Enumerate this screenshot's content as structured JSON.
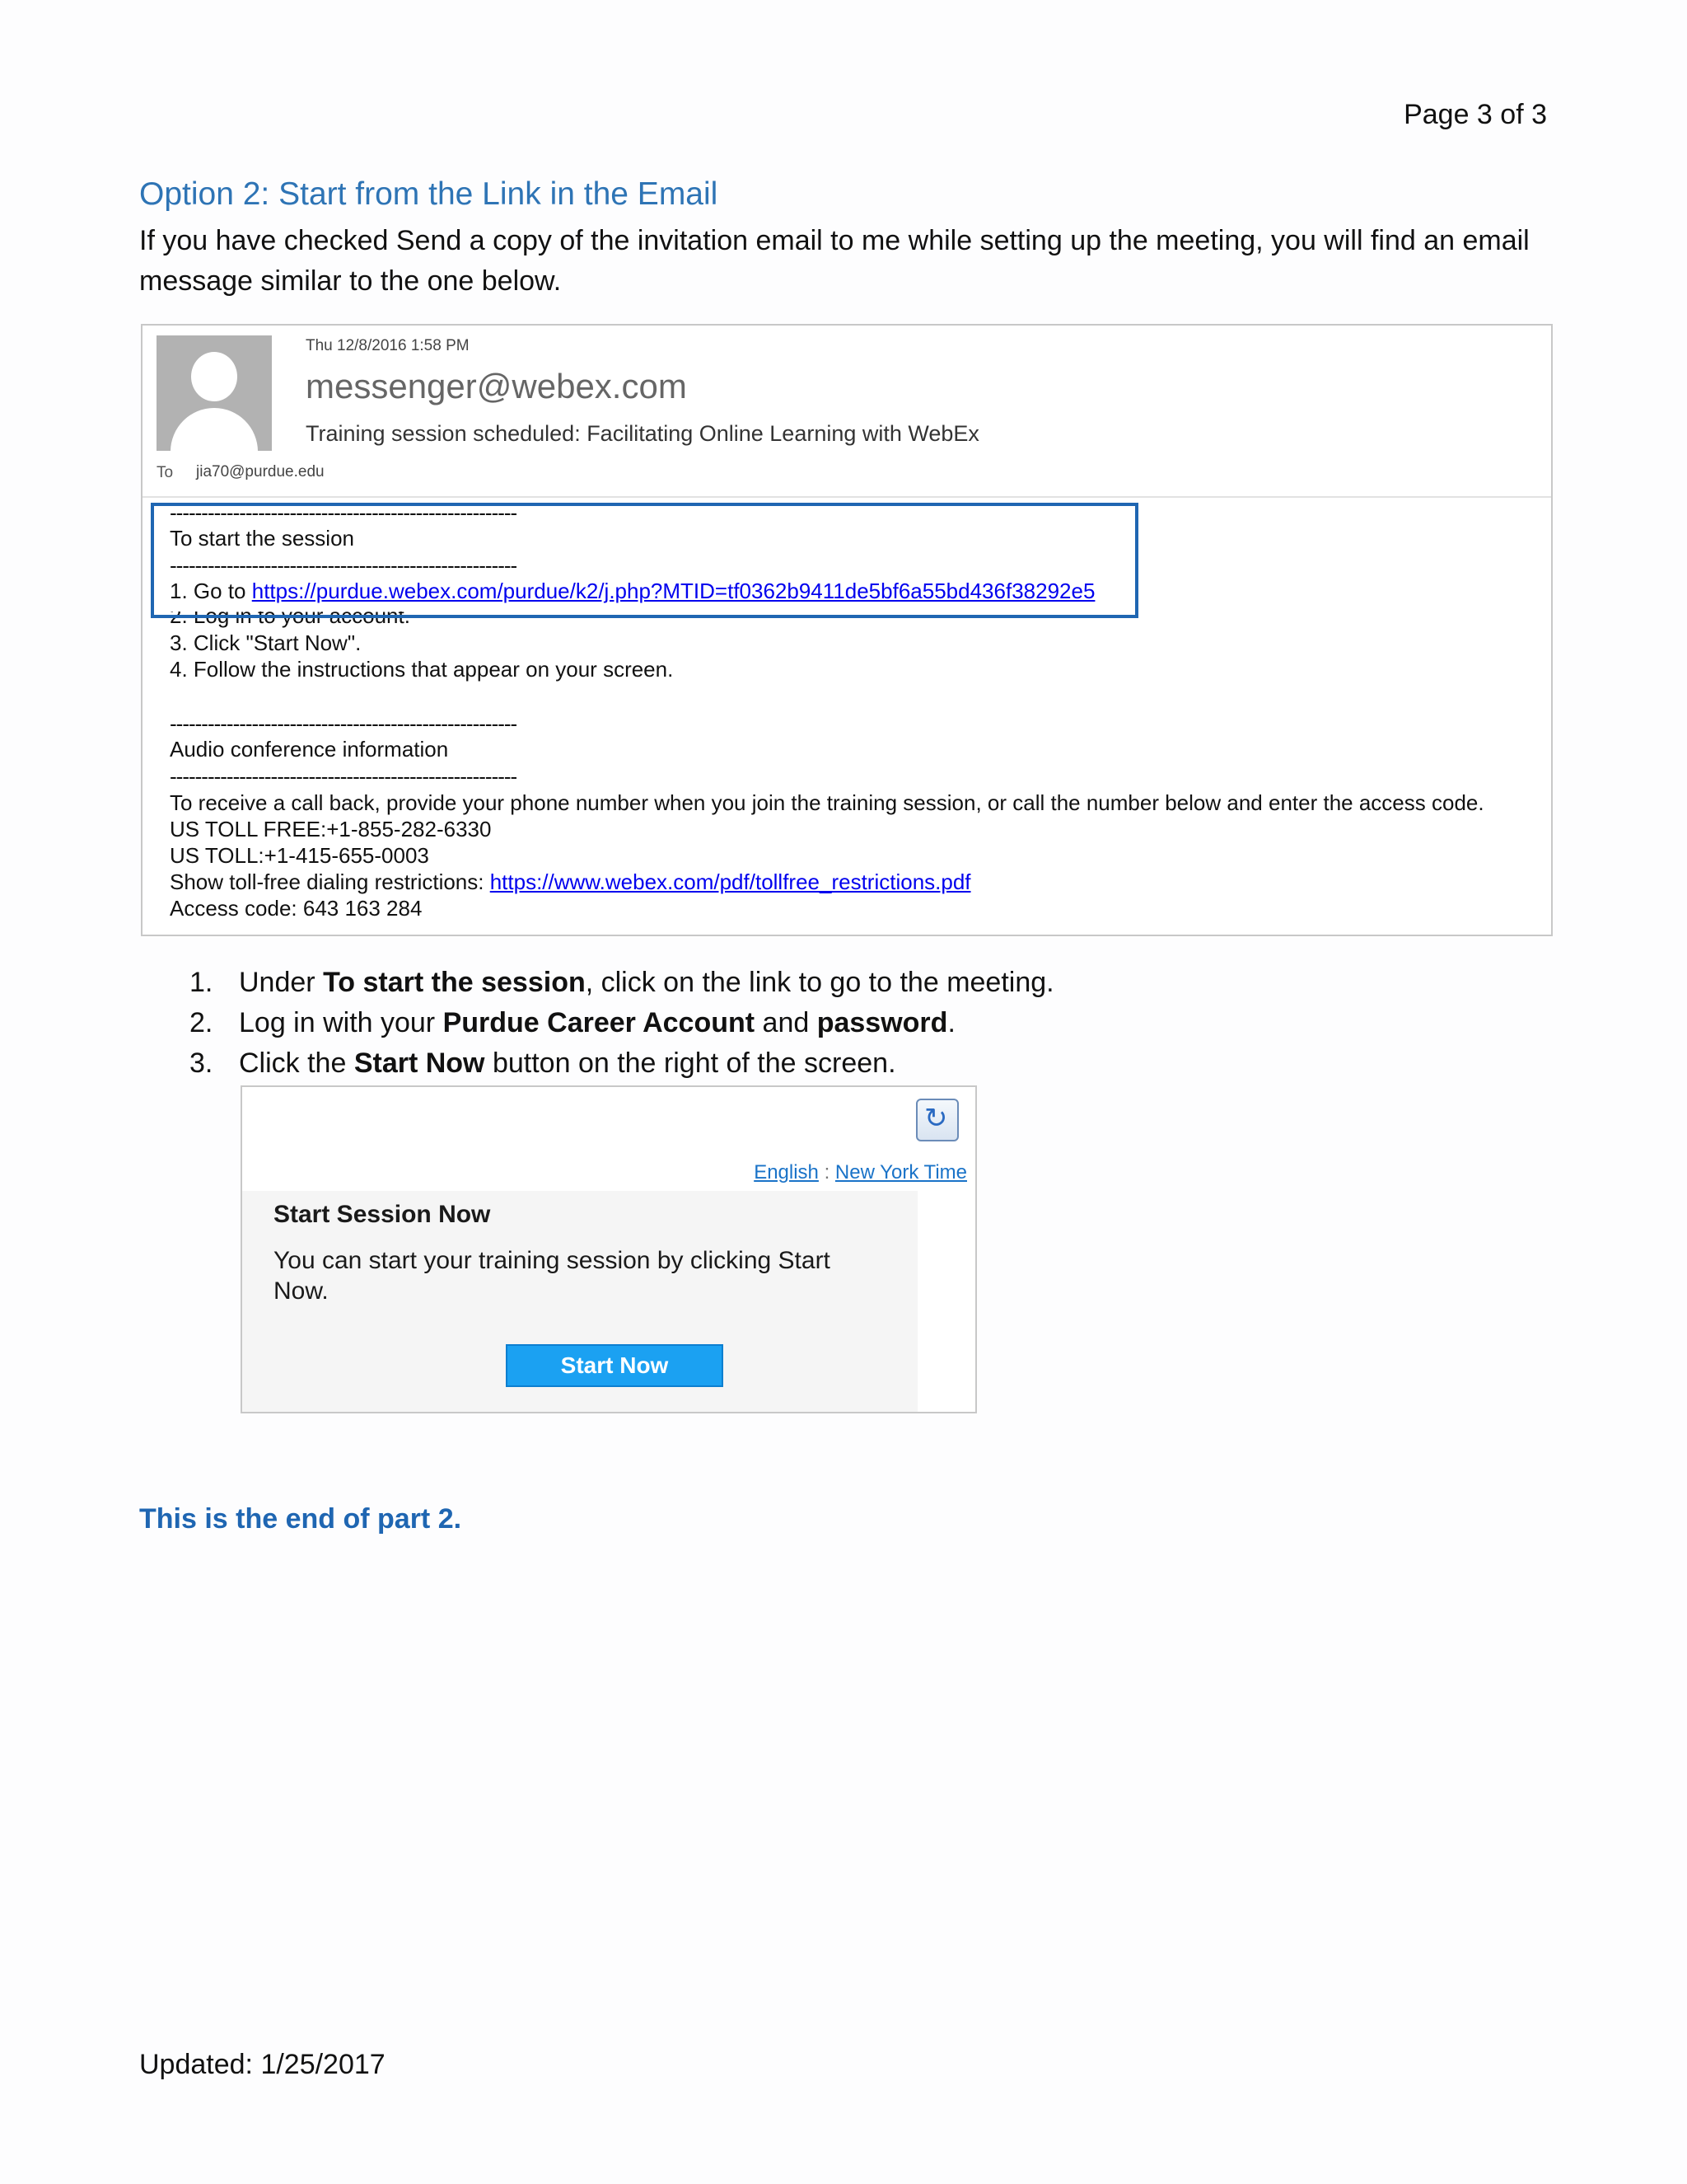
{
  "page_number": "Page 3 of 3",
  "section_title": "Option 2: Start from the Link in the Email",
  "intro": "If you have checked Send a copy of the invitation email to me while setting up the meeting, you will find an email message similar to the one below.",
  "email": {
    "date": "Thu 12/8/2016 1:58 PM",
    "from": "messenger@webex.com",
    "subject": "Training session scheduled: Facilitating Online Learning with WebEx",
    "to_label": "To",
    "to": "jia70@purdue.edu",
    "separator": "-------------------------------------------------------",
    "start_heading": "To start the session",
    "step1_prefix": "1. Go to ",
    "step1_link": "https://purdue.webex.com/purdue/k2/j.php?MTID=tf0362b9411de5bf6a55bd436f38292e5",
    "step2": "2. Log in to your account.",
    "step3": "3. Click \"Start Now\".",
    "step4": "4. Follow the instructions that appear on your screen.",
    "audio_heading": "Audio conference information",
    "callback": "To receive a call back, provide your phone number when you join the training session, or call the number below and enter the access code.",
    "toll_free": "US TOLL FREE:+1-855-282-6330",
    "toll": "US TOLL:+1-415-655-0003",
    "restrictions_prefix": "Show toll-free dialing restrictions: ",
    "restrictions_link": "https://www.webex.com/pdf/tollfree_restrictions.pdf",
    "access_code": "Access code: 643 163 284"
  },
  "steps": [
    {
      "num": "1.",
      "pre": "Under ",
      "bold1": "To start the session",
      "mid": ", click on the link to go to the meeting.",
      "bold2": "",
      "post": ""
    },
    {
      "num": "2.",
      "pre": "Log in with your ",
      "bold1": "Purdue Career Account",
      "mid": " and ",
      "bold2": "password",
      "post": "."
    },
    {
      "num": "3.",
      "pre": "Click the ",
      "bold1": "Start Now",
      "mid": " button on the right of the screen.",
      "bold2": "",
      "post": ""
    }
  ],
  "panel": {
    "language": "English",
    "lang_sep": " : ",
    "timezone": "New York Time",
    "title": "Start Session Now",
    "text": "You can start your training session by clicking Start Now.",
    "button": "Start Now",
    "icon": "refresh-icon"
  },
  "end_note": "This is the end of part 2.",
  "updated": "Updated:  1/25/2017"
}
